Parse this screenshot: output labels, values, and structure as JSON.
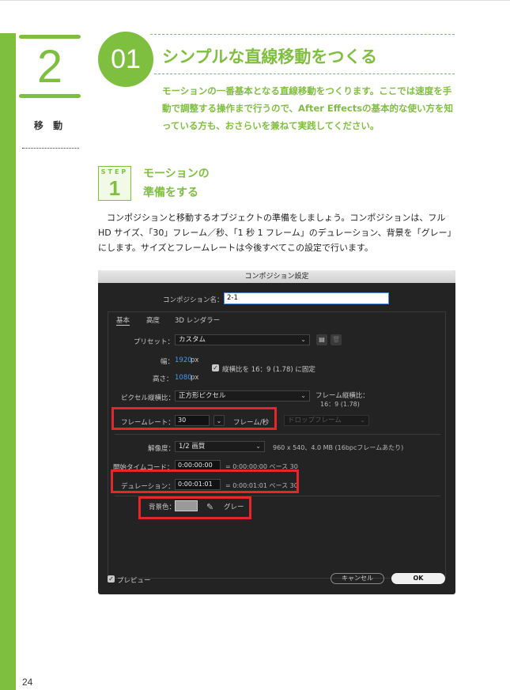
{
  "chapter": {
    "number": "2",
    "label": "移 動"
  },
  "page_number": "24",
  "section": {
    "number": "01",
    "title": "シンプルな直線移動をつくる",
    "description": "モーションの一番基本となる直線移動をつくります。ここでは速度を手動で調整する操作まで行うので、After Effectsの基本的な使い方を知っている方も、おさらいを兼ねて実践してください。"
  },
  "step": {
    "word": "STEP",
    "number": "1",
    "title_line1": "モーションの",
    "title_line2": "準備をする"
  },
  "body_text": "コンポジションと移動するオブジェクトの準備をしましょう。コンポジションは、フル HD サイズ、「30」フレーム／秒、「1 秒 1 フレーム」のデュレーション、背景を「グレー」にします。サイズとフレームレートは今後すべてこの設定で行います。",
  "dialog": {
    "title": "コンポジション設定",
    "name_label": "コンポジション名：",
    "name_value": "2-1",
    "tabs": [
      "基本",
      "高度",
      "3D レンダラー"
    ],
    "preset_label": "プリセット：",
    "preset_value": "カスタム",
    "width_label": "幅：",
    "width_value": "1920",
    "width_unit": "px",
    "height_label": "高さ：",
    "height_value": "1080",
    "height_unit": "px",
    "lock_aspect": "縦横比を 16：9 (1.78) に固定",
    "pixel_aspect_label": "ピクセル縦横比：",
    "pixel_aspect_value": "正方形ピクセル",
    "frame_aspect_label": "フレーム縦横比：",
    "frame_aspect_value": "16：9 (1.78)",
    "framerate_label": "フレームレート：",
    "framerate_value": "30",
    "framerate_unit": "フレーム/秒",
    "drop_frame": "ドロップフレーム",
    "resolution_label": "解像度：",
    "resolution_value": "1/2 画質",
    "resolution_info": "960 x 540、4.0 MB (16bpcフレームあたり)",
    "start_tc_label": "開始タイムコード：",
    "start_tc_value": "0:00:00:00",
    "start_tc_info": "= 0:00:00:00  ベース 30",
    "duration_label": "デュレーション：",
    "duration_value": "0:00:01:01",
    "duration_info": "= 0:00:01:01  ベース 30",
    "bg_label": "背景色：",
    "bg_name": "グレー",
    "bg_color": "#9a9a9a",
    "preview_label": "プレビュー",
    "cancel_label": "キャンセル",
    "ok_label": "OK"
  },
  "colors": {
    "accent": "#7fbf3f",
    "highlight": "#e5262a",
    "dialog_bg": "#232323"
  }
}
